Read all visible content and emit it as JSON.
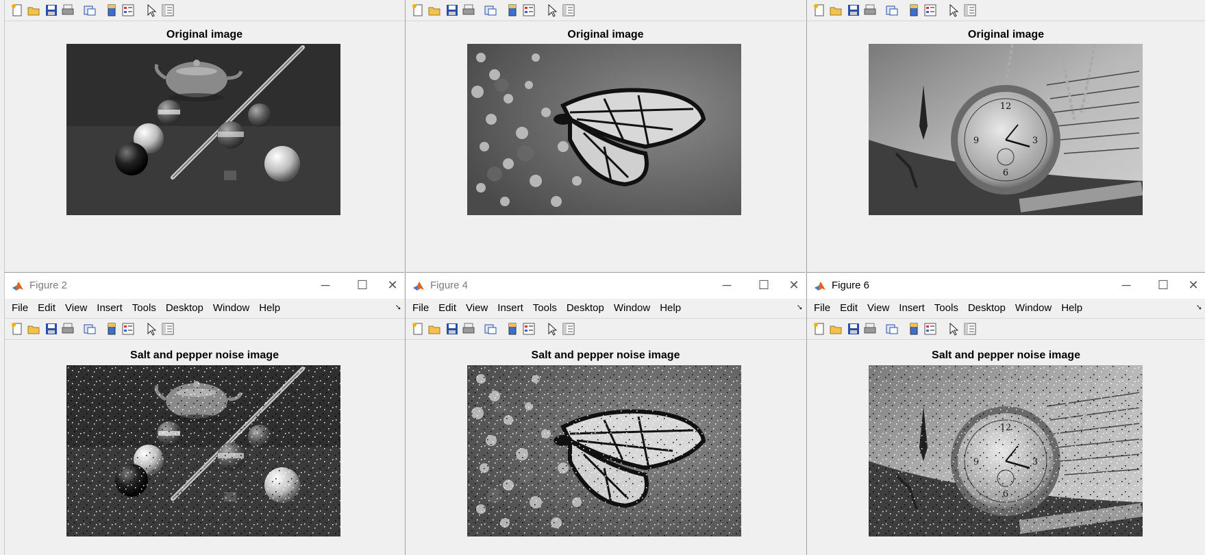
{
  "top_row": {
    "panels": [
      {
        "axes_title": "Original image",
        "image": "billiards-teapot-scene"
      },
      {
        "axes_title": "Original image",
        "image": "monarch-butterfly-on-flowers"
      },
      {
        "axes_title": "Original image",
        "image": "pocket-watch-on-book"
      }
    ]
  },
  "bottom_row": {
    "windows": [
      {
        "title": "Figure 2",
        "axes_title": "Salt and pepper noise image",
        "image": "billiards-teapot-scene-noisy"
      },
      {
        "title": "Figure 4",
        "axes_title": "Salt and pepper noise image",
        "image": "monarch-butterfly-on-flowers-noisy"
      },
      {
        "title": "Figure 6",
        "axes_title": "Salt and pepper noise image",
        "image": "pocket-watch-on-book-noisy"
      }
    ]
  },
  "menu": [
    "File",
    "Edit",
    "View",
    "Insert",
    "Tools",
    "Desktop",
    "Window",
    "Help"
  ],
  "toolbar_icons": [
    "new-figure-icon",
    "open-file-icon",
    "save-icon",
    "print-icon",
    "link-plot-icon",
    "insert-colorbar-icon",
    "insert-legend-icon",
    "edit-plot-arrow-icon",
    "property-inspector-icon"
  ],
  "window_controls": {
    "minimize": "─",
    "maximize": "☐",
    "close": "✕"
  },
  "colors": {
    "window_bg": "#f0f0f0",
    "titlebar_bg": "#ffffff",
    "inactive_title": "#7a7a7a"
  }
}
